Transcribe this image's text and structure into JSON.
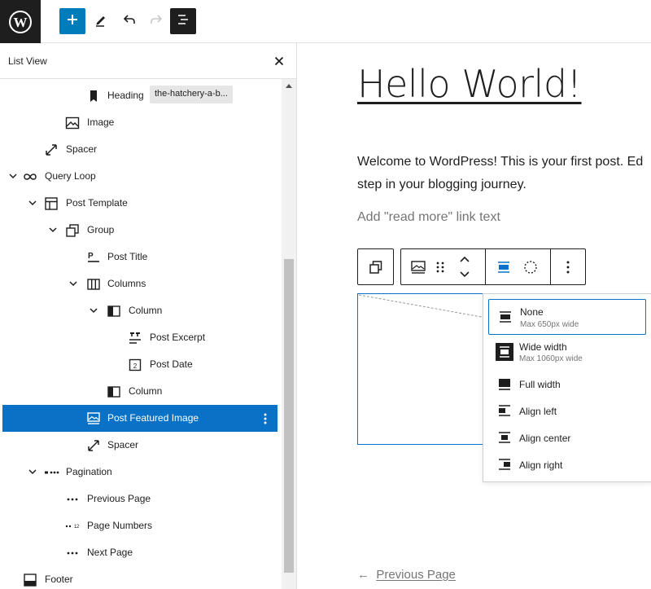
{
  "app": {
    "brand_color": "#1e1e1e",
    "accent": "#007cba",
    "selection": "#0a72c6"
  },
  "toolbar": {
    "icons": [
      "wordpress-icon",
      "plus-icon",
      "pencil-icon",
      "undo-icon",
      "redo-icon",
      "list-view-icon"
    ]
  },
  "sidebar": {
    "title": "List View",
    "items": [
      {
        "label": "Heading",
        "icon": "bookmark-icon",
        "anchor": "the-hatchery-a-b..."
      },
      {
        "label": "Image",
        "icon": "image-icon"
      },
      {
        "label": "Spacer",
        "icon": "spacer-icon"
      },
      {
        "label": "Query Loop",
        "icon": "loop-icon",
        "expanded": true
      },
      {
        "label": "Post Template",
        "icon": "layout-icon",
        "expanded": true
      },
      {
        "label": "Group",
        "icon": "group-icon",
        "expanded": true
      },
      {
        "label": "Post Title",
        "icon": "post-title-icon"
      },
      {
        "label": "Columns",
        "icon": "columns-icon",
        "expanded": true
      },
      {
        "label": "Column",
        "icon": "column-icon",
        "expanded": true
      },
      {
        "label": "Post Excerpt",
        "icon": "post-excerpt-icon"
      },
      {
        "label": "Post Date",
        "icon": "post-date-icon"
      },
      {
        "label": "Column",
        "icon": "column-icon"
      },
      {
        "label": "Post Featured Image",
        "icon": "featured-image-icon",
        "selected": true
      },
      {
        "label": "Spacer",
        "icon": "spacer-icon"
      },
      {
        "label": "Pagination",
        "icon": "pagination-icon",
        "expanded": true
      },
      {
        "label": "Previous Page",
        "icon": "previous-page-icon"
      },
      {
        "label": "Page Numbers",
        "icon": "page-numbers-icon"
      },
      {
        "label": "Next Page",
        "icon": "next-page-icon"
      },
      {
        "label": "Footer",
        "icon": "footer-icon"
      }
    ]
  },
  "canvas": {
    "title": "Hello World!",
    "excerpt_line1": "Welcome to WordPress! This is your first post. Ed",
    "excerpt_line2": "step in your blogging journey.",
    "read_more_placeholder": "Add \"read more\" link text",
    "pagination": {
      "arrow": "←",
      "previous": "Previous Page"
    }
  },
  "align_menu": {
    "items": [
      {
        "label": "None",
        "sub": "Max 650px wide",
        "icon": "align-none-icon",
        "active": true
      },
      {
        "label": "Wide width",
        "sub": "Max 1060px wide",
        "icon": "align-wide-icon"
      },
      {
        "label": "Full width",
        "sub": "",
        "icon": "align-full-icon"
      },
      {
        "label": "Align left",
        "sub": "",
        "icon": "align-left-icon"
      },
      {
        "label": "Align center",
        "sub": "",
        "icon": "align-center-icon"
      },
      {
        "label": "Align right",
        "sub": "",
        "icon": "align-right-icon"
      }
    ]
  }
}
